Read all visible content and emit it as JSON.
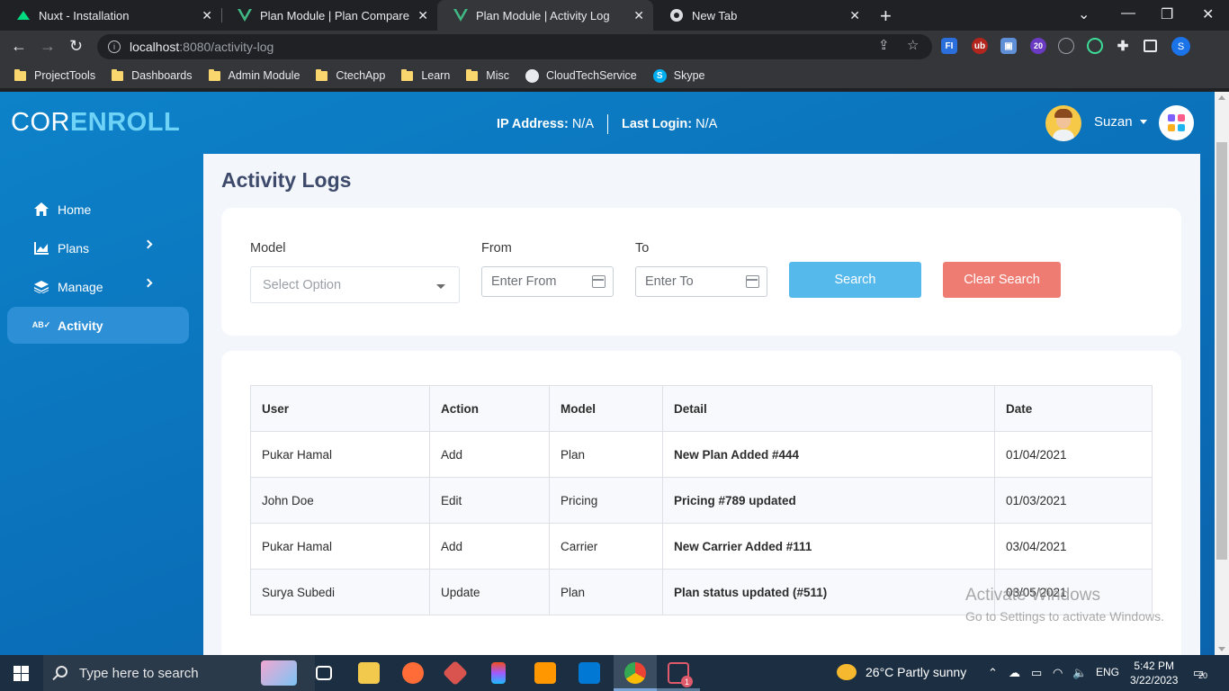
{
  "browser": {
    "tabs": [
      {
        "title": "Nuxt - Installation",
        "icon": "nuxt-icon",
        "active": false
      },
      {
        "title": "Plan Module | Plan Compare",
        "icon": "vue-icon",
        "active": false
      },
      {
        "title": "Plan Module | Activity Log",
        "icon": "vue-icon",
        "active": true
      },
      {
        "title": "New Tab",
        "icon": "chrome-icon",
        "active": false
      }
    ],
    "url_host": "localhost",
    "url_path": ":8080/activity-log",
    "profile_initial": "S",
    "ext_badge": "20",
    "bookmarks": [
      {
        "label": "ProjectTools",
        "icon": "folder-icon"
      },
      {
        "label": "Dashboards",
        "icon": "folder-icon"
      },
      {
        "label": "Admin Module",
        "icon": "folder-icon"
      },
      {
        "label": "CtechApp",
        "icon": "folder-icon"
      },
      {
        "label": "Learn",
        "icon": "folder-icon"
      },
      {
        "label": "Misc",
        "icon": "folder-icon"
      },
      {
        "label": "CloudTechService",
        "icon": "github-icon"
      },
      {
        "label": "Skype",
        "icon": "skype-icon"
      }
    ]
  },
  "app": {
    "logo_part1": "COR",
    "logo_part2": "ENROLL",
    "ip_label": "IP Address:",
    "ip_value": "N/A",
    "login_label": "Last Login:",
    "login_value": "N/A",
    "user_name": "Suzan",
    "colors": {
      "accent": "#0d82c9",
      "search": "#55b9ec",
      "clear": "#ef7c73",
      "logo_accent": "#6fd3f7"
    }
  },
  "sidebar": {
    "items": [
      {
        "label": "Home",
        "icon": "home-icon",
        "has_submenu": false,
        "active": false
      },
      {
        "label": "Plans",
        "icon": "chart-icon",
        "has_submenu": true,
        "active": false
      },
      {
        "label": "Manage",
        "icon": "layers-icon",
        "has_submenu": true,
        "active": false
      },
      {
        "label": "Activity",
        "icon": "activity-icon",
        "has_submenu": false,
        "active": true
      }
    ]
  },
  "page": {
    "title": "Activity Logs"
  },
  "filters": {
    "model_label": "Model",
    "model_placeholder": "Select Option",
    "from_label": "From",
    "from_placeholder": "Enter From",
    "to_label": "To",
    "to_placeholder": "Enter To",
    "search_label": "Search",
    "clear_label": "Clear Search"
  },
  "table": {
    "columns": [
      "User",
      "Action",
      "Model",
      "Detail",
      "Date"
    ],
    "rows": [
      [
        "Pukar Hamal",
        "Add",
        "Plan",
        "New Plan Added #444",
        "01/04/2021"
      ],
      [
        "John Doe",
        "Edit",
        "Pricing",
        "Pricing #789 updated",
        "01/03/2021"
      ],
      [
        "Pukar Hamal",
        "Add",
        "Carrier",
        "New Carrier Added #111",
        "03/04/2021"
      ],
      [
        "Surya Subedi",
        "Update",
        "Plan",
        "Plan status updated (#511)",
        "03/05/2021"
      ]
    ]
  },
  "watermark": {
    "line1": "Activate Windows",
    "line2": "Go to Settings to activate Windows."
  },
  "taskbar": {
    "search_placeholder": "Type here to search",
    "weather": "26°C  Partly sunny",
    "language": "ENG",
    "time": "5:42 PM",
    "date": "3/22/2023",
    "notification_count": "20",
    "app_badge": "1"
  }
}
